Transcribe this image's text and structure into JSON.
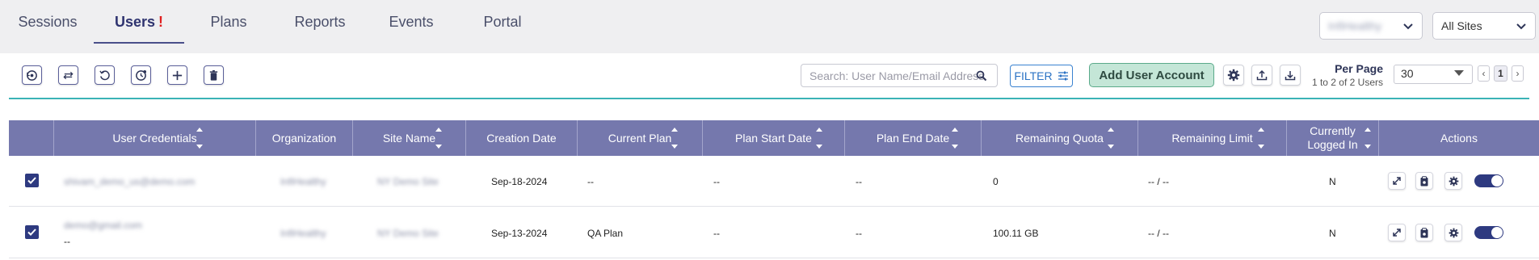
{
  "nav": {
    "tabs": [
      {
        "label": "Sessions"
      },
      {
        "label": "Users",
        "alert": "!"
      },
      {
        "label": "Plans"
      },
      {
        "label": "Reports"
      },
      {
        "label": "Events"
      },
      {
        "label": "Portal"
      }
    ],
    "active_tab": "Users",
    "org_select_value": "InfiHealthy",
    "site_select_value": "All Sites"
  },
  "toolbar": {
    "icons": [
      "restore-icon",
      "transfer-icon",
      "refresh-icon",
      "reset-quota-icon",
      "add-icon",
      "delete-icon"
    ],
    "search_placeholder": "Search: User Name/Email Address",
    "filter_label": "FILTER",
    "add_user_label": "Add User Account"
  },
  "pagination": {
    "per_page_label": "Per Page",
    "count_text": "1 to 2 of 2 Users",
    "per_page_value": "30",
    "current_page": "1",
    "prev": "‹",
    "next": "›"
  },
  "table": {
    "columns": [
      "User Credentials",
      "Organization",
      "Site Name",
      "Creation Date",
      "Current Plan",
      "Plan Start Date",
      "Plan End Date",
      "Remaining Quota",
      "Remaining Limit",
      "Currently Logged In",
      "Actions"
    ],
    "rows": [
      {
        "user": "shivam_demo_us@demo.com",
        "user2": "",
        "org": "InfiHealthy",
        "site": "NY Demo Site",
        "created": "Sep-18-2024",
        "plan": "--",
        "start": "--",
        "end": "--",
        "quota": "0",
        "limit": "-- / --",
        "logged_in": "N",
        "checked": true,
        "enabled": true
      },
      {
        "user": "demo@gmail.com",
        "user2": "--",
        "org": "InfiHealthy",
        "site": "NY Demo Site",
        "created": "Sep-13-2024",
        "plan": "QA Plan",
        "start": "--",
        "end": "--",
        "quota": "100.11 GB",
        "limit": "-- / --",
        "logged_in": "N",
        "checked": true,
        "enabled": true
      }
    ]
  },
  "colors": {
    "header_bg": "#7578ad",
    "accent": "#2e3a80",
    "divider": "#3bb3b6",
    "add_button_bg": "#c4e6d7"
  }
}
